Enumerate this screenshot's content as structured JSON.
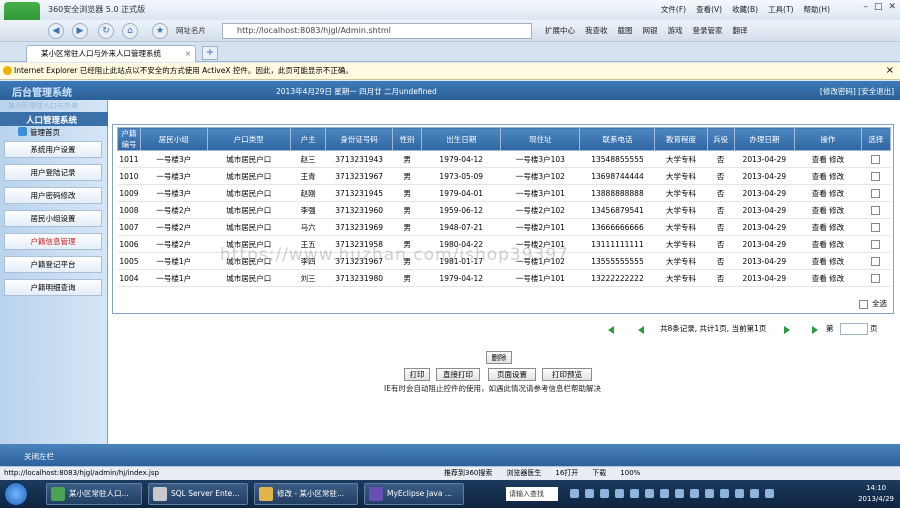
{
  "browser": {
    "app_title": "360安全浏览器 5.0 正式版",
    "logo_label": "请登录",
    "menus": [
      "文件(F)",
      "查看(V)",
      "收藏(B)",
      "工具(T)",
      "帮助(H)"
    ],
    "fav_label": "网址名片",
    "url": "http://localhost:8083/hjgl/Admin.shtml",
    "toolbar": [
      "扩展中心",
      "我查收",
      "截图",
      "网银",
      "游戏",
      "登录管家",
      "翻译"
    ],
    "tab_title": "某小区常驻人口与外来人口管理系统",
    "infobar_text": "Internet Explorer 已经阻止此站点以不安全的方式使用 ActiveX 控件。因此，此页可能显示不正确。",
    "status_url": "http://localhost:8083/hjgl/admin/hj/index.jsp",
    "status_items": [
      "推荐到360搜索",
      "浏览器医生",
      "16打开",
      "下载",
      "100%"
    ]
  },
  "header": {
    "brand": "后台管理系统",
    "date_text": "2013年4月29日 星期一 四月廿 二月undefined",
    "links": "[修改密码] [安全退出]"
  },
  "sidebar": {
    "subtitle": "某小区常驻人口与外来",
    "title": "人口管理系统",
    "home": "管理首页",
    "items": [
      {
        "label": "系统用户设置"
      },
      {
        "label": "用户登陆记录"
      },
      {
        "label": "用户密码修改"
      },
      {
        "label": "居民小组设置"
      },
      {
        "label": "户籍信息管理"
      },
      {
        "label": "户籍登记平台"
      },
      {
        "label": "户籍明细查询"
      }
    ],
    "close_left": "关闭左栏"
  },
  "table": {
    "headers": [
      "户籍编号",
      "居民小组",
      "户口类型",
      "户主",
      "身份证号码",
      "性别",
      "出生日期",
      "现住址",
      "联系电话",
      "教育程度",
      "兵役",
      "办理日期",
      "操作",
      "选择"
    ],
    "rows": [
      [
        "1011",
        "一号楼3户",
        "城市居民户口",
        "赵三",
        "3713231943",
        "男",
        "1979-04-12",
        "一号楼3户103",
        "13548855555",
        "大学专科",
        "否",
        "2013-04-29",
        "查看 修改"
      ],
      [
        "1010",
        "一号楼3户",
        "城市居民户口",
        "王青",
        "3713231967",
        "男",
        "1973-05-09",
        "一号楼3户102",
        "13698744444",
        "大学专科",
        "否",
        "2013-04-29",
        "查看 修改"
      ],
      [
        "1009",
        "一号楼3户",
        "城市居民户口",
        "赵刚",
        "3713231945",
        "男",
        "1979-04-01",
        "一号楼3户101",
        "13888888888",
        "大学专科",
        "否",
        "2013-04-29",
        "查看 修改"
      ],
      [
        "1008",
        "一号楼2户",
        "城市居民户口",
        "李强",
        "3713231960",
        "男",
        "1959-06-12",
        "一号楼2户102",
        "13456879541",
        "大学专科",
        "否",
        "2013-04-29",
        "查看 修改"
      ],
      [
        "1007",
        "一号楼2户",
        "城市居民户口",
        "马六",
        "3713231969",
        "男",
        "1948-07-21",
        "一号楼2户101",
        "13666666666",
        "大学专科",
        "否",
        "2013-04-29",
        "查看 修改"
      ],
      [
        "1006",
        "一号楼2户",
        "城市居民户口",
        "王五",
        "3713231958",
        "男",
        "1980-04-22",
        "一号楼2户101",
        "13111111111",
        "大学专科",
        "否",
        "2013-04-29",
        "查看 修改"
      ],
      [
        "1005",
        "一号楼1户",
        "城市居民户口",
        "李四",
        "3713231967",
        "男",
        "1981-01-17",
        "一号楼1户102",
        "13555555555",
        "大学专科",
        "否",
        "2013-04-29",
        "查看 修改"
      ],
      [
        "1004",
        "一号楼1户",
        "城市居民户口",
        "刘三",
        "3713231980",
        "男",
        "1979-04-12",
        "一号楼1户101",
        "13222222222",
        "大学专科",
        "否",
        "2013-04-29",
        "查看 修改"
      ]
    ],
    "select_all": "全选"
  },
  "pager": {
    "summary": "共8条记录, 共计1页, 当前第1页",
    "goto_prefix": "第",
    "goto_suffix": "页"
  },
  "actions": {
    "delete": "删除",
    "print": "打印",
    "direct_print": "直接打印",
    "page_setup": "页面设置",
    "print_preview": "打印预览",
    "ie_hint": "IE有时会自动阻止控件的使用，如遇此情况请参考信息栏帮助解决"
  },
  "watermark": "https://www.huzhan.com/ishop39397",
  "taskbar": {
    "tasks": [
      "某小区常驻人口...",
      "SQL Server Ente...",
      "修改 - 某小区常驻...",
      "MyEclipse Java ..."
    ],
    "search_placeholder": "请输入查找",
    "time": "14:10",
    "date": "2013/4/29"
  },
  "colors": {
    "header_blue": "#2f66a2",
    "active_menu": "#c62020",
    "pager_green": "#2a9d3a"
  }
}
